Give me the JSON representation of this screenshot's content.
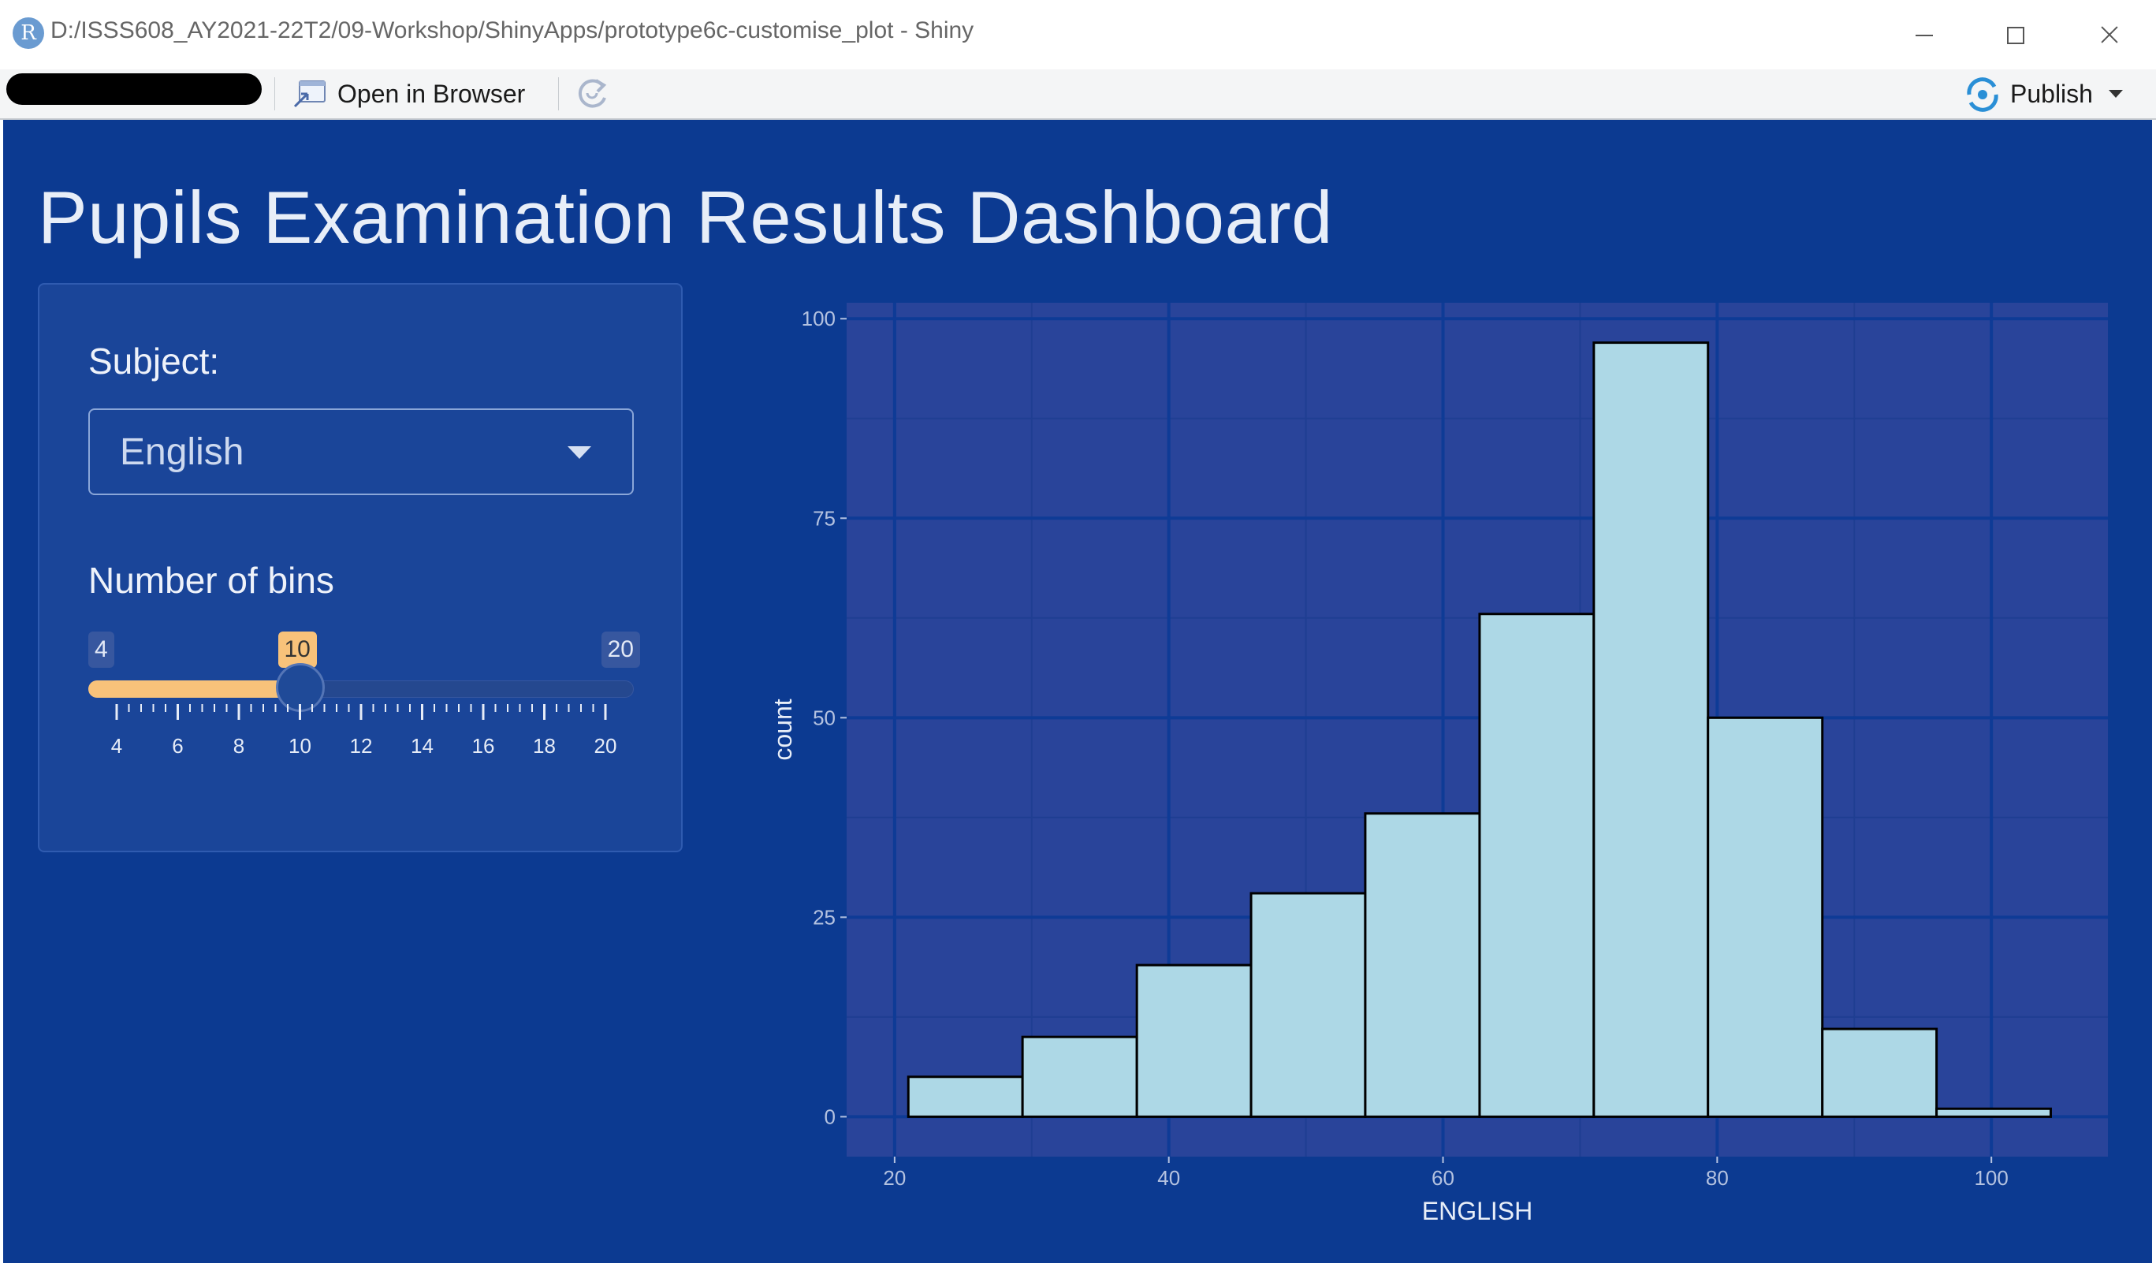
{
  "window": {
    "title": "D:/ISSS608_AY2021-22T2/09-Workshop/ShinyApps/prototype6c-customise_plot - Shiny",
    "app_icon_letter": "R"
  },
  "toolbar": {
    "open_browser_label": "Open in Browser",
    "publish_label": "Publish"
  },
  "page": {
    "title": "Pupils Examination Results Dashboard"
  },
  "controls": {
    "subject_label": "Subject:",
    "subject_value": "English",
    "bins_label": "Number of bins",
    "bins_min": "4",
    "bins_max": "20",
    "bins_value": "10",
    "bins_value_fraction": 0.375,
    "bins_tick_labels": [
      "4",
      "6",
      "8",
      "10",
      "12",
      "14",
      "16",
      "18",
      "20"
    ]
  },
  "colors": {
    "app_background": "#0c3a91",
    "plot_panel": "#29449a",
    "bar_fill": "#add8e6",
    "slider_accent": "#f8c27a"
  },
  "chart_data": {
    "type": "bar",
    "xlabel": "ENGLISH",
    "ylabel": "count",
    "xlim": [
      16.5,
      108.5
    ],
    "ylim": [
      -5,
      102
    ],
    "x_ticks": [
      20,
      40,
      60,
      80,
      100
    ],
    "y_ticks": [
      0,
      25,
      50,
      75,
      100
    ],
    "grid": true,
    "bins": [
      {
        "x0": 21,
        "x1": 29.33,
        "count": 5
      },
      {
        "x0": 29.33,
        "x1": 37.67,
        "count": 10
      },
      {
        "x0": 37.67,
        "x1": 46,
        "count": 19
      },
      {
        "x0": 46,
        "x1": 54.33,
        "count": 28
      },
      {
        "x0": 54.33,
        "x1": 62.67,
        "count": 38
      },
      {
        "x0": 62.67,
        "x1": 71,
        "count": 63
      },
      {
        "x0": 71,
        "x1": 79.33,
        "count": 97
      },
      {
        "x0": 79.33,
        "x1": 87.67,
        "count": 50
      },
      {
        "x0": 87.67,
        "x1": 96,
        "count": 11
      },
      {
        "x0": 96,
        "x1": 104.33,
        "count": 1
      }
    ]
  }
}
